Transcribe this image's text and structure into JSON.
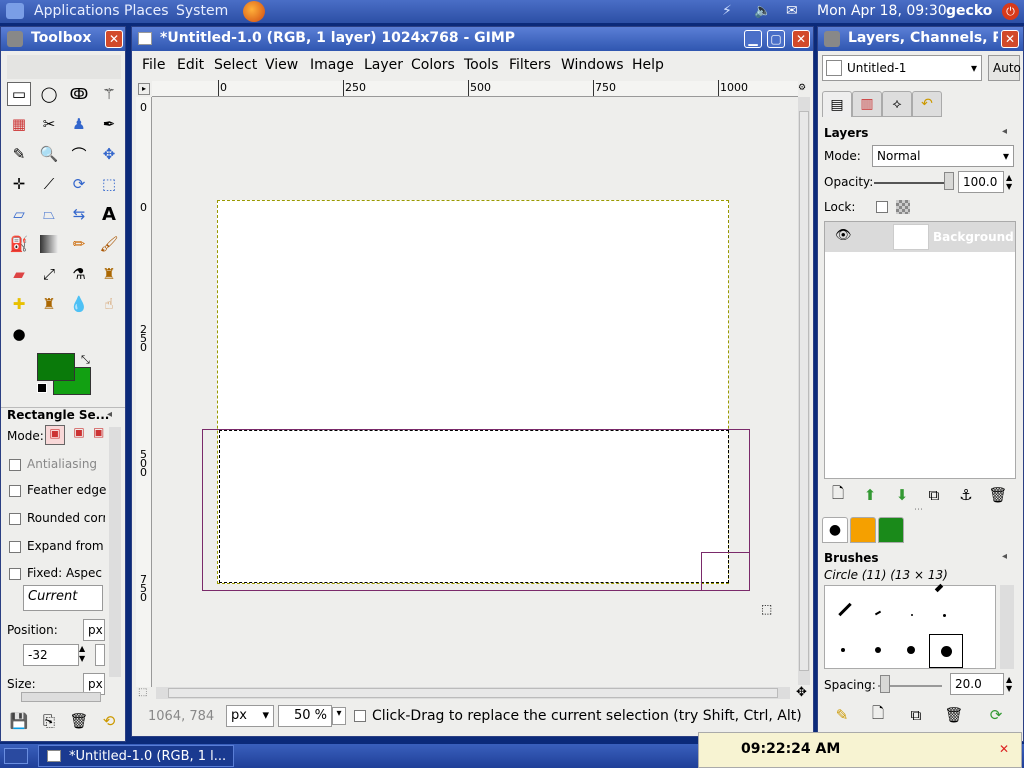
{
  "top_panel": {
    "menus": [
      "Applications",
      "Places",
      "System"
    ],
    "clock": "Mon Apr 18, 09:30",
    "user": "gecko"
  },
  "toolbox": {
    "title": "Toolbox",
    "tool_options_title": "Rectangle Se...",
    "mode_label": "Mode:",
    "options": [
      "Antialiasing",
      "Feather edge",
      "Rounded corr",
      "Expand from",
      "Fixed:  Aspec"
    ],
    "current": "Current",
    "position_label": "Position:",
    "position_unit": "px",
    "position_value": "-32",
    "size_label": "Size:",
    "size_unit": "px"
  },
  "image_window": {
    "title": "*Untitled-1.0 (RGB, 1 layer) 1024x768 - GIMP",
    "menus": [
      "File",
      "Edit",
      "Select",
      "View",
      "Image",
      "Layer",
      "Colors",
      "Tools",
      "Filters",
      "Windows",
      "Help"
    ],
    "ruler_labels": [
      "0",
      "250",
      "500",
      "750",
      "1000"
    ],
    "vruler_labels": [
      "0",
      "250",
      "500",
      "750"
    ],
    "coords": "1064, 784",
    "unit": "px",
    "zoom": "50 %",
    "status": "Click-Drag to replace the current selection (try Shift, Ctrl, Alt)"
  },
  "layers": {
    "title": "Layers, Channels, P",
    "image_select": "Untitled-1",
    "auto_label": "Auto",
    "section": "Layers",
    "mode_label": "Mode:",
    "mode_value": "Normal",
    "opacity_label": "Opacity:",
    "opacity_value": "100.0",
    "opacity_level": 1.0,
    "lock_label": "Lock:",
    "layer_name": "Background",
    "brushes_title": "Brushes",
    "brush_name": "Circle (11) (13 × 13)",
    "spacing_label": "Spacing:",
    "spacing_value": "20.0"
  },
  "bottom_panel": {
    "task": "*Untitled-1.0 (RGB, 1 l...",
    "time": "09:22:24 AM"
  },
  "colors": {
    "fg": "#0a7a0a",
    "bg": "#12a012",
    "selection": "#7a2a6a"
  }
}
